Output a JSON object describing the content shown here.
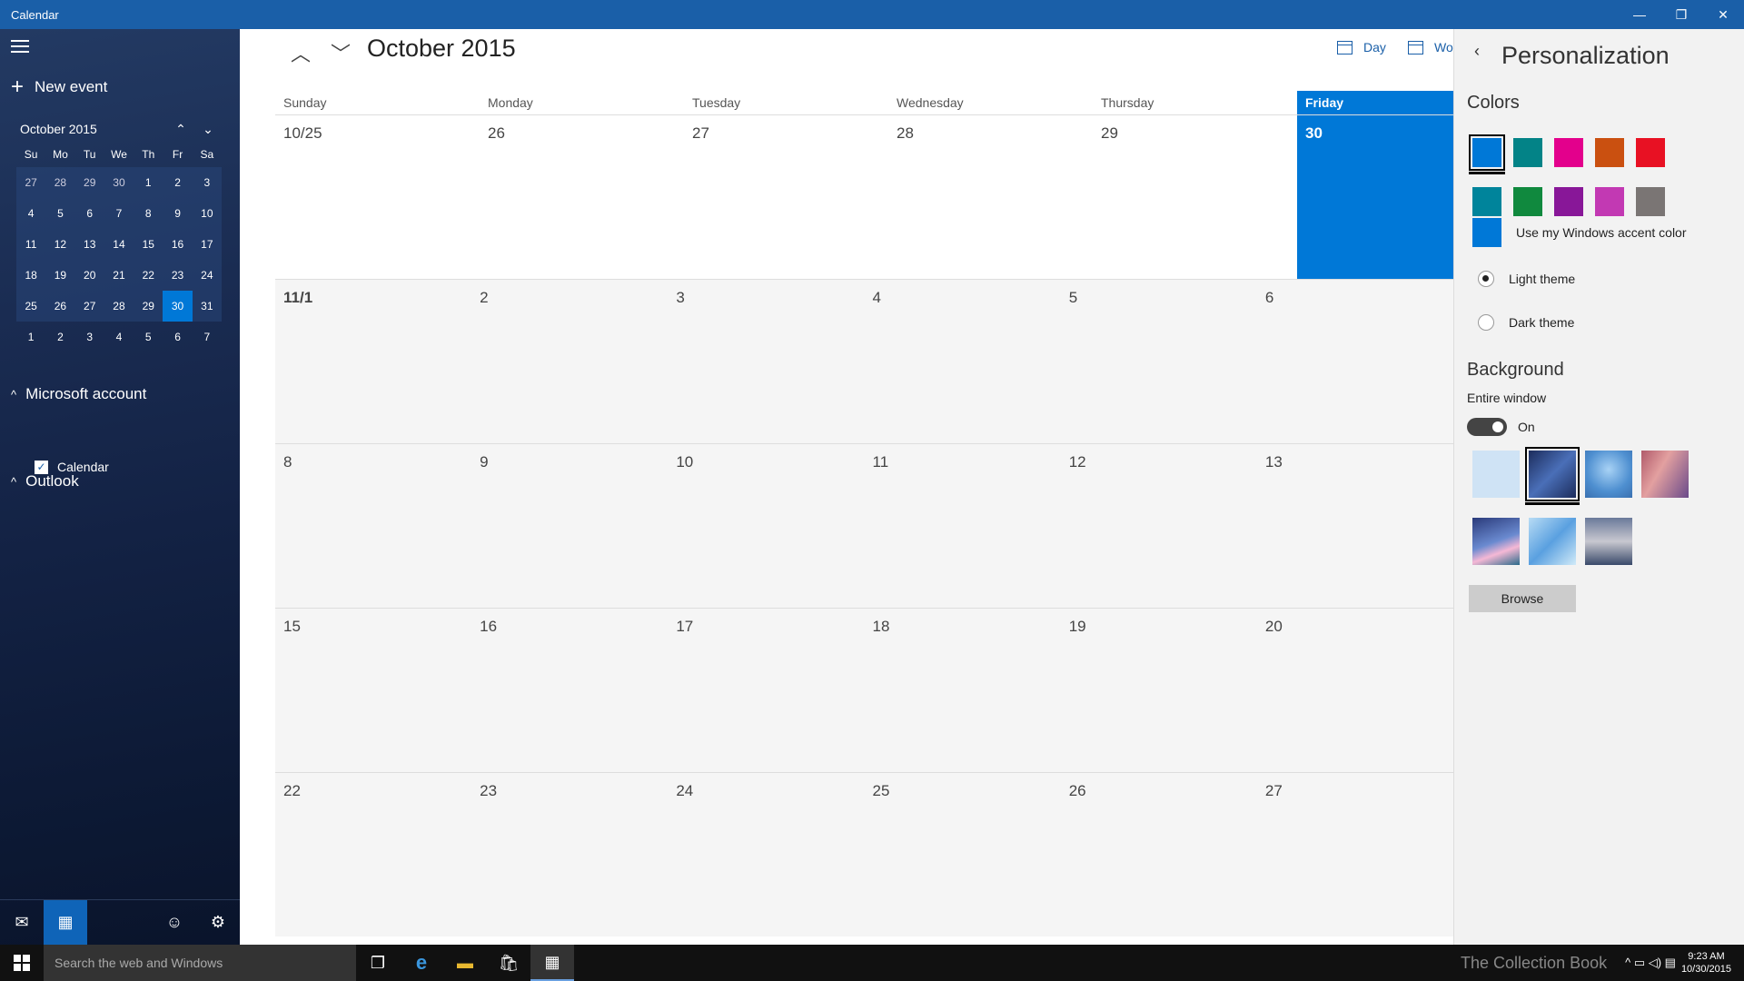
{
  "window": {
    "title": "Calendar",
    "minimize": "—",
    "restore": "❐",
    "close": "✕"
  },
  "sidebar": {
    "new_event": "New event",
    "plus": "+",
    "mini_cal": {
      "month": "October 2015",
      "up": "⌃",
      "down": "⌄",
      "weekdays": [
        "Su",
        "Mo",
        "Tu",
        "We",
        "Th",
        "Fr",
        "Sa"
      ],
      "weeks": [
        [
          "27",
          "28",
          "29",
          "30",
          "1",
          "2",
          "3"
        ],
        [
          "4",
          "5",
          "6",
          "7",
          "8",
          "9",
          "10"
        ],
        [
          "11",
          "12",
          "13",
          "14",
          "15",
          "16",
          "17"
        ],
        [
          "18",
          "19",
          "20",
          "21",
          "22",
          "23",
          "24"
        ],
        [
          "25",
          "26",
          "27",
          "28",
          "29",
          "30",
          "31"
        ],
        [
          "1",
          "2",
          "3",
          "4",
          "5",
          "6",
          "7"
        ]
      ],
      "today": "30"
    },
    "accounts": [
      {
        "name": "Microsoft account",
        "chev": "^"
      },
      {
        "name": "Outlook",
        "chev": "^"
      }
    ],
    "calendar_check": {
      "label": "Calendar",
      "mark": "✓"
    },
    "bottom": {
      "mail": "✉",
      "calendar": "▦",
      "smile": "☺",
      "settings": "⚙"
    }
  },
  "main": {
    "month_title": "October 2015",
    "nav_up": "︿",
    "nav_down": "﹀",
    "view_day": "Day",
    "view_work": "Wor",
    "day_headers": [
      "Sunday",
      "Monday",
      "Tuesday",
      "Wednesday",
      "Thursday",
      "Friday"
    ],
    "weeks": [
      [
        "10/25",
        "26",
        "27",
        "28",
        "29",
        "30"
      ],
      [
        "11/1",
        "2",
        "3",
        "4",
        "5",
        "6"
      ],
      [
        "8",
        "9",
        "10",
        "11",
        "12",
        "13"
      ],
      [
        "15",
        "16",
        "17",
        "18",
        "19",
        "20"
      ],
      [
        "22",
        "23",
        "24",
        "25",
        "26",
        "27"
      ]
    ]
  },
  "panel": {
    "back": "‹",
    "title": "Personalization",
    "colors_heading": "Colors",
    "swatches_row1": [
      "#0078d7",
      "#038387",
      "#e3008c",
      "#ca5010",
      "#e81123"
    ],
    "swatches_row2": [
      "#00849b",
      "#10893e",
      "#881798",
      "#c239b3",
      "#7a7574"
    ],
    "accent_label": "Use my Windows accent color",
    "light_theme": "Light theme",
    "dark_theme": "Dark theme",
    "background_heading": "Background",
    "entire_window": "Entire window",
    "toggle_label": "On",
    "browse": "Browse"
  },
  "taskbar": {
    "search_placeholder": "Search the web and Windows",
    "task_view": "❐",
    "edge": "e",
    "explorer": "▬",
    "store": "🛍",
    "calendar": "▦",
    "watermark": "The Collection Book",
    "tray": "^  ▭  ◁)  ▤",
    "time": "9:23 AM",
    "date": "10/30/2015"
  }
}
